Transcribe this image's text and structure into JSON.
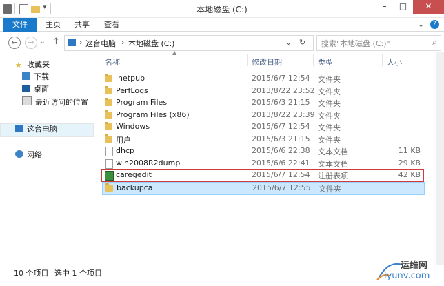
{
  "window": {
    "title": "本地磁盘 (C:)",
    "minimize": "–",
    "maximize": "□",
    "close": "✕"
  },
  "ribbon": {
    "tabs": [
      "文件",
      "主页",
      "共享",
      "查看"
    ],
    "expand": "⌄",
    "help": "?"
  },
  "nav": {
    "back": "←",
    "forward": "→",
    "up": "↑",
    "refresh": "↻",
    "dropdown": "⌄"
  },
  "address": {
    "segments": [
      "这台电脑",
      "本地磁盘 (C:)"
    ],
    "sep": "›"
  },
  "search": {
    "placeholder": "搜索\"本地磁盘 (C:)\"",
    "icon": "⌕"
  },
  "sidebar": {
    "favorites": "收藏夹",
    "items": [
      "下载",
      "桌面",
      "最近访问的位置"
    ],
    "this_pc": "这台电脑",
    "network": "网络"
  },
  "columns": [
    "名称",
    "修改日期",
    "类型",
    "大小"
  ],
  "files": [
    {
      "name": "inetpub",
      "date": "2015/6/7 12:54",
      "type": "文件夹",
      "size": "",
      "kind": "folder"
    },
    {
      "name": "PerfLogs",
      "date": "2013/8/22 23:52",
      "type": "文件夹",
      "size": "",
      "kind": "folder"
    },
    {
      "name": "Program Files",
      "date": "2015/6/3 21:15",
      "type": "文件夹",
      "size": "",
      "kind": "folder"
    },
    {
      "name": "Program Files (x86)",
      "date": "2013/8/22 23:39",
      "type": "文件夹",
      "size": "",
      "kind": "folder"
    },
    {
      "name": "Windows",
      "date": "2015/6/7 12:54",
      "type": "文件夹",
      "size": "",
      "kind": "folder"
    },
    {
      "name": "用户",
      "date": "2015/6/3 21:15",
      "type": "文件夹",
      "size": "",
      "kind": "folder"
    },
    {
      "name": "dhcp",
      "date": "2015/6/6 22:38",
      "type": "文本文档",
      "size": "11 KB",
      "kind": "doc"
    },
    {
      "name": "win2008R2dump",
      "date": "2015/6/6 22:41",
      "type": "文本文档",
      "size": "29 KB",
      "kind": "doc"
    },
    {
      "name": "caregedit",
      "date": "2015/6/7 12:54",
      "type": "注册表项",
      "size": "42 KB",
      "kind": "reg"
    },
    {
      "name": "backupca",
      "date": "2015/6/7 12:55",
      "type": "文件夹",
      "size": "",
      "kind": "folder"
    }
  ],
  "status": {
    "count": "10 个项目",
    "selected": "选中 1 个项目"
  },
  "watermark": {
    "cn": "运维网",
    "url": "iyunv.com"
  },
  "colors": {
    "accent": "#1979ca",
    "selection": "#cce8ff",
    "highlight_border": "#d23b3b"
  }
}
